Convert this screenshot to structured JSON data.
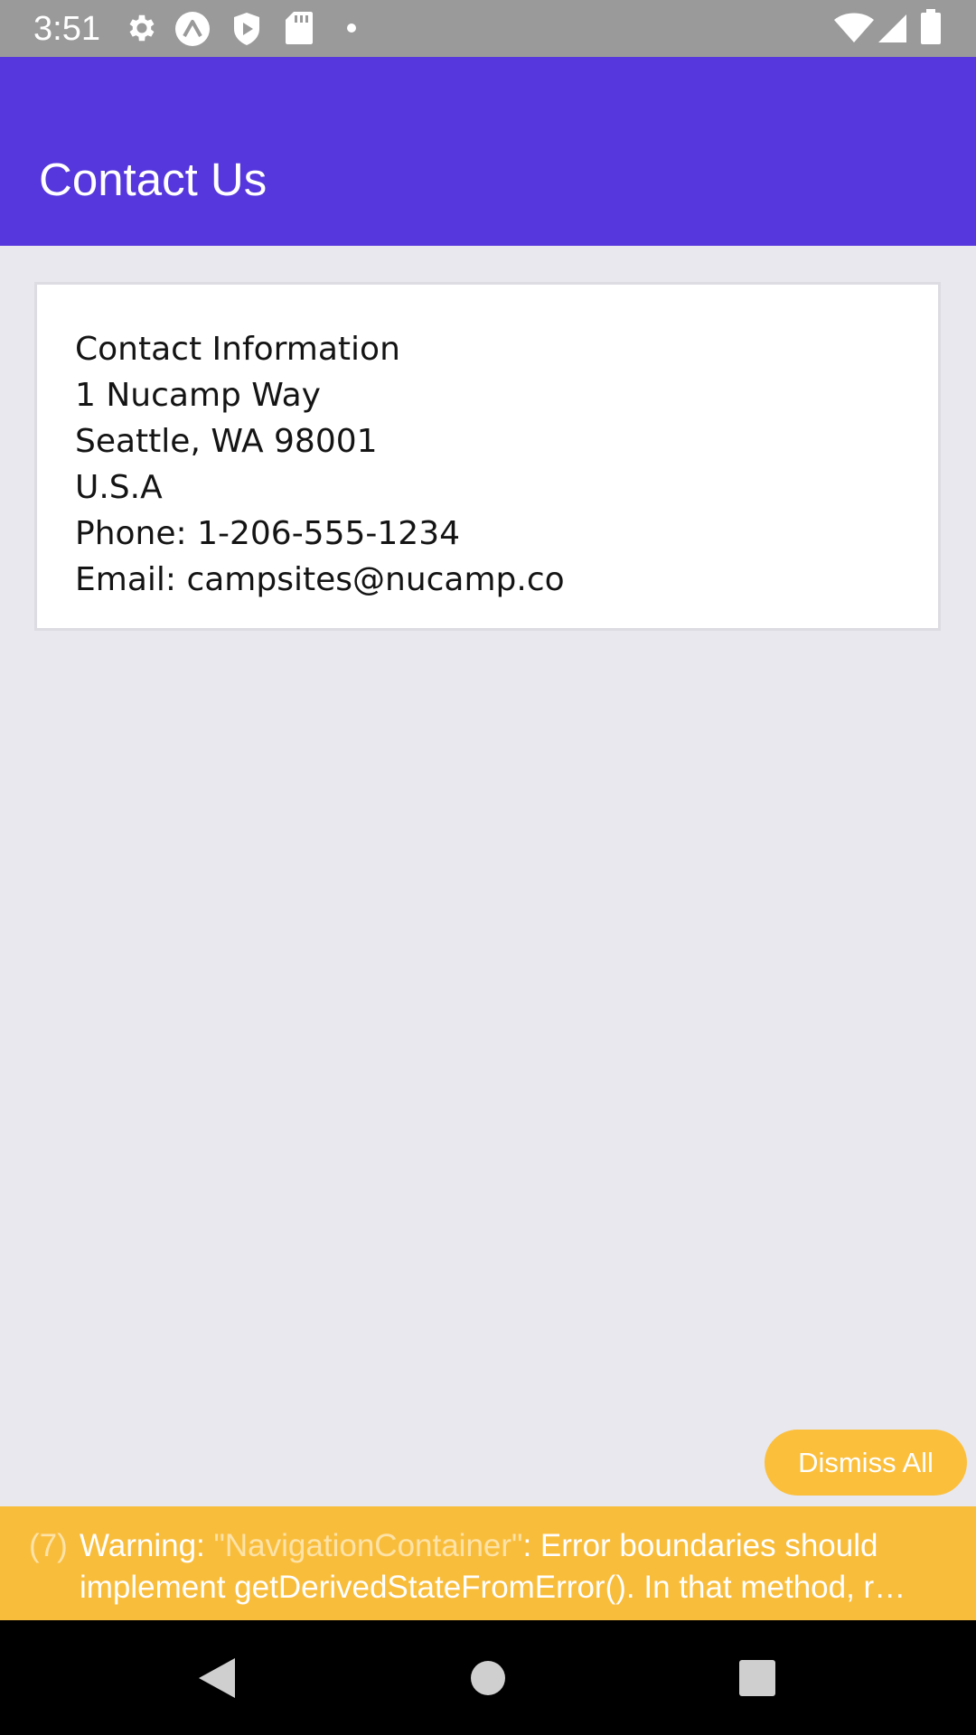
{
  "status_bar": {
    "time": "3:51",
    "left_icons": [
      "gear-icon",
      "expo-icon",
      "shield-play-icon",
      "sd-card-icon",
      "dot-icon"
    ],
    "right_icons": [
      "wifi-icon",
      "cell-signal-icon",
      "battery-icon"
    ]
  },
  "app_bar": {
    "title": "Contact Us",
    "color": "#5637dd"
  },
  "contact_card": {
    "heading": "Contact Information",
    "address_line1": "1 Nucamp Way",
    "address_line2": "Seattle, WA 98001",
    "country": "U.S.A",
    "phone": "Phone: 1-206-555-1234",
    "email": "Email: campsites@nucamp.co"
  },
  "dismiss_button": {
    "label": "Dismiss All"
  },
  "warning": {
    "count": "(7)",
    "prefix": "Warning: ",
    "component": "\"NavigationContainer\"",
    "line1_rest": ": Error boundaries should",
    "line2": "implement getDerivedStateFromError(). In that method, r…",
    "color": "#f9bd3c"
  },
  "nav_bar": {
    "buttons": [
      "back-icon",
      "home-icon",
      "recents-icon"
    ]
  }
}
